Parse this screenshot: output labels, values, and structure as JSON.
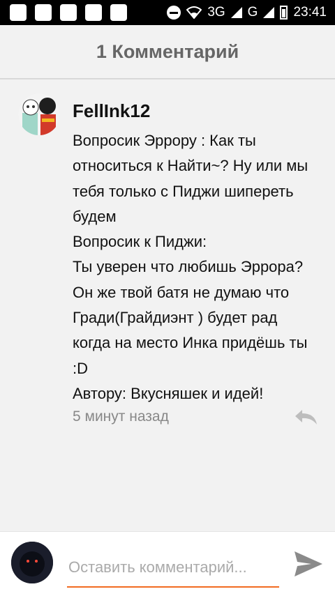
{
  "status_bar": {
    "network1": "3G",
    "network2": "G",
    "time": "23:41"
  },
  "header": {
    "title": "1 Комментарий"
  },
  "comment": {
    "username": "FellInk12",
    "text": "Вопросик Эррору : Как ты относиться к Найти~? Ну или мы тебя только с Пиджи шипереть будем\nВопросик к Пиджи:\nТы уверен что любишь Эррора? Он же твой батя не думаю что Гради(Грайдиэнт ) будет рад когда на место Инка придёшь ты :D\nАвтору: Вкусняшек и идей!",
    "time": "5 минут назад",
    "icons": {
      "avatar": "user-avatar",
      "reply": "reply-icon"
    }
  },
  "composer": {
    "placeholder": "Оставить комментарий...",
    "icons": {
      "avatar": "current-user-avatar",
      "send": "send-icon"
    }
  },
  "colors": {
    "accent": "#f26b21",
    "header_text": "#666666",
    "background": "#f2f2f2"
  }
}
